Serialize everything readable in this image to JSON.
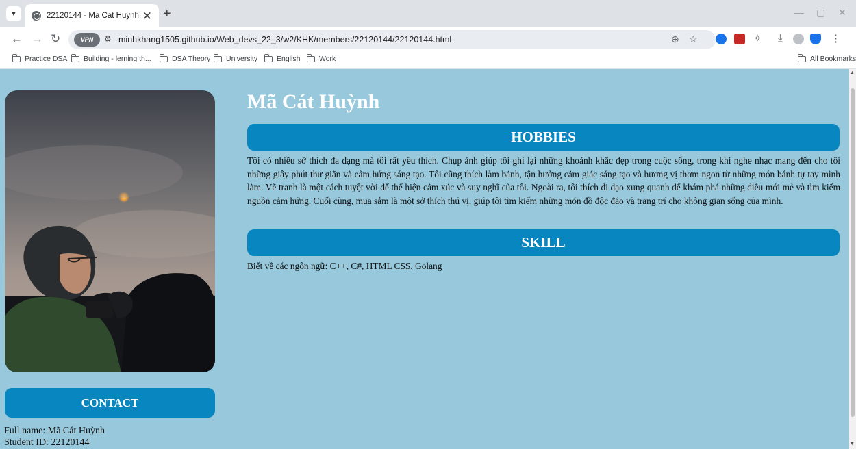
{
  "browser": {
    "tab_title": "22120144 - Ma Cat Huynh",
    "url": "minhkhang1505.github.io/Web_devs_22_3/w2/KHK/members/22120144/22120144.html",
    "vpn_label": "VPN",
    "bookmarks": [
      "Practice DSA",
      "Building - lerning th...",
      "DSA Theory",
      "University",
      "English",
      "Work"
    ],
    "all_bookmarks": "All Bookmarks"
  },
  "profile": {
    "name": "Mã Cát Huỳnh",
    "contact_label": "CONTACT",
    "full_name_line": "Full name: Mã Cát Huỳnh",
    "student_id_line": "Student ID: 22120144"
  },
  "hobbies": {
    "title": "HOBBIES",
    "text": "Tôi có nhiều sở thích đa dạng mà tôi rất yêu thích. Chụp ảnh giúp tôi ghi lại những khoảnh khắc đẹp trong cuộc sống, trong khi nghe nhạc mang đến cho tôi những giây phút thư giãn và cảm hứng sáng tạo. Tôi cũng thích làm bánh, tận hưởng cảm giác sáng tạo và hương vị thơm ngon từ những món bánh tự tay mình làm. Vẽ tranh là một cách tuyệt vời để thể hiện cảm xúc và suy nghĩ của tôi. Ngoài ra, tôi thích đi dạo xung quanh để khám phá những điều mới mẻ và tìm kiếm nguồn cảm hứng. Cuối cùng, mua sắm là một sở thích thú vị, giúp tôi tìm kiếm những món đồ độc đáo và trang trí cho không gian sống của mình."
  },
  "skill": {
    "title": "SKILL",
    "text": "Biết về các ngôn ngữ: C++, C#, HTML CSS, Golang"
  },
  "colors": {
    "page_background": "#98c8db",
    "section_bar": "#0886c0",
    "heading_text": "#ffffff"
  }
}
